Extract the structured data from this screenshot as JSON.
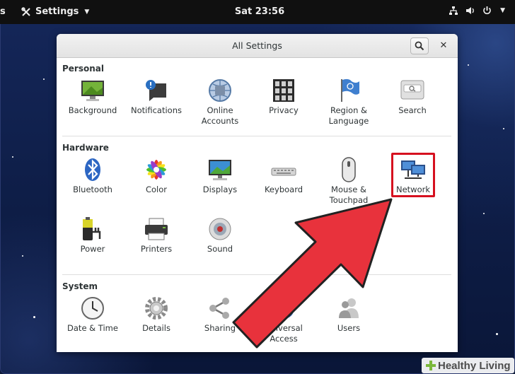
{
  "topbar": {
    "left_fragment": "s",
    "app_menu_label": "Settings",
    "clock": "Sat 23:56"
  },
  "window": {
    "title": "All Settings",
    "sections": [
      {
        "label": "Personal",
        "items": [
          {
            "label": "Background",
            "icon": "background-icon"
          },
          {
            "label": "Notifications",
            "icon": "notifications-icon"
          },
          {
            "label": "Online\nAccounts",
            "icon": "online-accounts-icon"
          },
          {
            "label": "Privacy",
            "icon": "privacy-icon"
          },
          {
            "label": "Region &\nLanguage",
            "icon": "region-language-icon"
          },
          {
            "label": "Search",
            "icon": "search-settings-icon"
          }
        ]
      },
      {
        "label": "Hardware",
        "items": [
          {
            "label": "Bluetooth",
            "icon": "bluetooth-icon"
          },
          {
            "label": "Color",
            "icon": "color-icon"
          },
          {
            "label": "Displays",
            "icon": "displays-icon"
          },
          {
            "label": "Keyboard",
            "icon": "keyboard-icon"
          },
          {
            "label": "Mouse &\nTouchpad",
            "icon": "mouse-touchpad-icon"
          },
          {
            "label": "Network",
            "icon": "network-icon"
          },
          {
            "label": "Power",
            "icon": "power-icon"
          },
          {
            "label": "Printers",
            "icon": "printers-icon"
          },
          {
            "label": "Sound",
            "icon": "sound-icon"
          }
        ]
      },
      {
        "label": "System",
        "items": [
          {
            "label": "Date & Time",
            "icon": "date-time-icon"
          },
          {
            "label": "Details",
            "icon": "details-icon"
          },
          {
            "label": "Sharing",
            "icon": "sharing-icon"
          },
          {
            "label": "Universal\nAccess",
            "icon": "universal-access-icon"
          },
          {
            "label": "Users",
            "icon": "users-icon"
          }
        ]
      }
    ]
  },
  "annotation": {
    "highlight_color": "#d6101f",
    "arrow_color": "#e8323c"
  },
  "watermark": {
    "text": "Healthy Living",
    "brand_color": "#7bb83b"
  }
}
